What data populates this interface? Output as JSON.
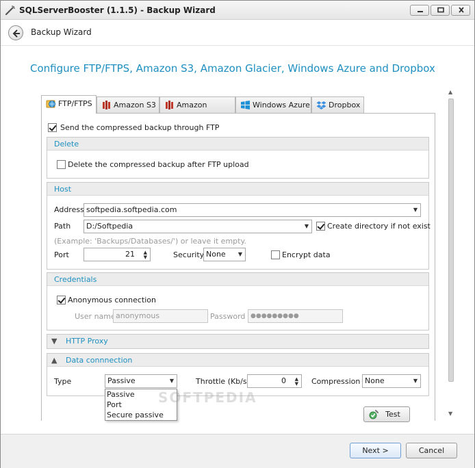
{
  "window": {
    "title": "SQLServerBooster (1.1.5) - Backup Wizard"
  },
  "header": {
    "title": "Backup Wizard"
  },
  "page": {
    "title": "Configure FTP/FTPS, Amazon S3, Amazon Glacier, Windows Azure and Dropbox"
  },
  "tabs": [
    {
      "label": "FTP/FTPS",
      "icon": "ftp-globe-icon"
    },
    {
      "label": "Amazon S3",
      "icon": "amazon-icon"
    },
    {
      "label": "Amazon Glacier",
      "icon": "amazon-icon"
    },
    {
      "label": "Windows Azure",
      "icon": "windows-icon"
    },
    {
      "label": "Dropbox",
      "icon": "dropbox-icon"
    }
  ],
  "ftp": {
    "send_label": "Send the compressed backup through FTP",
    "delete": {
      "header": "Delete",
      "checkbox_label": "Delete the compressed backup after FTP upload"
    },
    "host": {
      "header": "Host",
      "address_label": "Address",
      "address_value": "softpedia.softpedia.com",
      "path_label": "Path",
      "path_value": "D:/Softpedia",
      "create_dir_label": "Create directory if not exist",
      "hint": "(Example: 'Backups/Databases/') or leave it empty.",
      "port_label": "Port",
      "port_value": "21",
      "security_label": "Security",
      "security_value": "None",
      "encrypt_label": "Encrypt data"
    },
    "credentials": {
      "header": "Credentials",
      "anonymous_label": "Anonymous connection",
      "username_label": "User name",
      "username_value": "anonymous",
      "password_label": "Password",
      "password_value": "●●●●●●●●●"
    },
    "http_proxy": {
      "header": "HTTP Proxy"
    },
    "data_connection": {
      "header": "Data connnection",
      "type_label": "Type",
      "type_value": "Passive",
      "type_options": [
        "Passive",
        "Port",
        "Secure passive"
      ],
      "throttle_label": "Throttle (Kb/s)",
      "throttle_value": "0",
      "compression_label": "Compression",
      "compression_value": "None"
    },
    "test_label": "Test"
  },
  "watermark": "SOFTPEDIA",
  "footer": {
    "next_label": "Next >",
    "cancel_label": "Cancel"
  },
  "colors": {
    "accent": "#1e8fc0"
  }
}
